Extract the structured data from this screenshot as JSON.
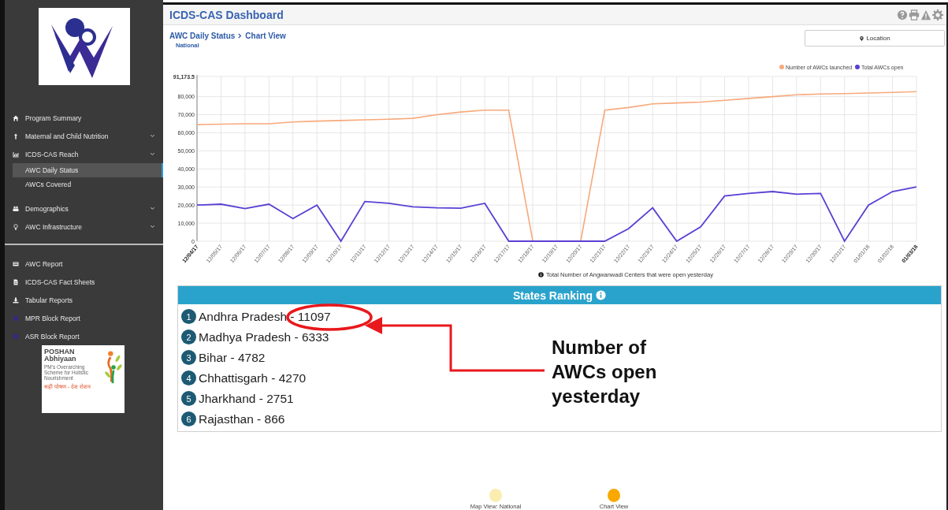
{
  "sidebar": {
    "menu": [
      {
        "label": "Program Summary",
        "has_submenu": false,
        "selected": false
      },
      {
        "label": "Maternal and Child Nutrition",
        "has_submenu": true,
        "selected": false
      },
      {
        "label": "ICDS-CAS Reach",
        "has_submenu": true,
        "selected": false,
        "children": [
          {
            "label": "AWC Daily Status",
            "selected": true
          },
          {
            "label": "AWCs Covered",
            "selected": false
          }
        ]
      },
      {
        "label": "Demographics",
        "has_submenu": true,
        "selected": false
      },
      {
        "label": "AWC Infrastructure",
        "has_submenu": true,
        "selected": false
      }
    ],
    "reports": [
      {
        "label": "AWC Report"
      },
      {
        "label": "ICDS-CAS Fact Sheets"
      },
      {
        "label": "Tabular Reports"
      },
      {
        "label": "MPR Block Report"
      },
      {
        "label": "ASR Block Report"
      }
    ],
    "partner_logo": {
      "title": "POSHAN",
      "subtitle": "Abhiyaan",
      "tagline": "PM's Overarching Scheme for Holistic Nourishment",
      "motto": "सही पोषण - देश रोशन"
    }
  },
  "header": {
    "title": "ICDS-CAS Dashboard"
  },
  "breadcrumb": {
    "section": "AWC Daily Status",
    "page": "Chart View",
    "location": "National"
  },
  "location_button": {
    "label": "Location"
  },
  "chart_data": {
    "type": "line",
    "grid": true,
    "legend": true,
    "categories": [
      "12/04/17",
      "12/05/17",
      "12/06/17",
      "12/07/17",
      "12/08/17",
      "12/09/17",
      "12/10/17",
      "12/11/17",
      "12/12/17",
      "12/13/17",
      "12/14/17",
      "12/15/17",
      "12/16/17",
      "12/17/17",
      "12/18/17",
      "12/19/17",
      "12/20/17",
      "12/21/17",
      "12/22/17",
      "12/23/17",
      "12/24/17",
      "12/25/17",
      "12/26/17",
      "12/27/17",
      "12/28/17",
      "12/29/17",
      "12/30/17",
      "12/31/17",
      "01/01/18",
      "01/02/18",
      "01/03/18"
    ],
    "series": [
      {
        "name": "Number of AWCs launched",
        "color": "#f7a97b",
        "values": [
          64500,
          64800,
          65000,
          65000,
          66000,
          66500,
          66800,
          67200,
          67500,
          68000,
          70000,
          71500,
          72500,
          72500,
          0,
          0,
          0,
          72500,
          74000,
          76000,
          76500,
          77000,
          78000,
          79000,
          80000,
          81000,
          81500,
          81700,
          82000,
          82300,
          82800
        ]
      },
      {
        "name": "Total AWCs open",
        "color": "#5b3fd4",
        "values": [
          20000,
          20500,
          18000,
          20500,
          12500,
          20000,
          0,
          22000,
          21000,
          19000,
          18500,
          18300,
          21000,
          0,
          0,
          0,
          0,
          0,
          7000,
          18500,
          0,
          8000,
          25000,
          26500,
          27500,
          26000,
          26500,
          0,
          20000,
          27500,
          30000
        ]
      }
    ],
    "ylim": [
      0,
      91173.5
    ],
    "yticks": [
      {
        "value": 0,
        "label": "0"
      },
      {
        "value": 10000,
        "label": "10,000"
      },
      {
        "value": 20000,
        "label": "20,000"
      },
      {
        "value": 30000,
        "label": "30,000"
      },
      {
        "value": 40000,
        "label": "40,000"
      },
      {
        "value": 50000,
        "label": "50,000"
      },
      {
        "value": 60000,
        "label": "60,000"
      },
      {
        "value": 70000,
        "label": "70,000"
      },
      {
        "value": 80000,
        "label": "80,000"
      },
      {
        "value": 91173.5,
        "label": "91,173.5"
      }
    ]
  },
  "chart_note": "Total Number of Angwanwadi Centers that were open yesterday",
  "ranking": {
    "title": "States Ranking",
    "items": [
      {
        "rank": "1",
        "label": "Andhra Pradesh - 11097",
        "highlighted": true
      },
      {
        "rank": "2",
        "label": "Madhya Pradesh - 6333",
        "highlighted": false
      },
      {
        "rank": "3",
        "label": "Bihar - 4782",
        "highlighted": false
      },
      {
        "rank": "4",
        "label": "Chhattisgarh - 4270",
        "highlighted": false
      },
      {
        "rank": "5",
        "label": "Jharkhand - 2751",
        "highlighted": false
      },
      {
        "rank": "6",
        "label": "Rajasthan - 866",
        "highlighted": false
      }
    ]
  },
  "callout": {
    "text": "Number of AWCs open yesterday"
  },
  "views": [
    {
      "label": "Map View: National",
      "selected": false
    },
    {
      "label": "Chart View",
      "selected": true
    }
  ]
}
